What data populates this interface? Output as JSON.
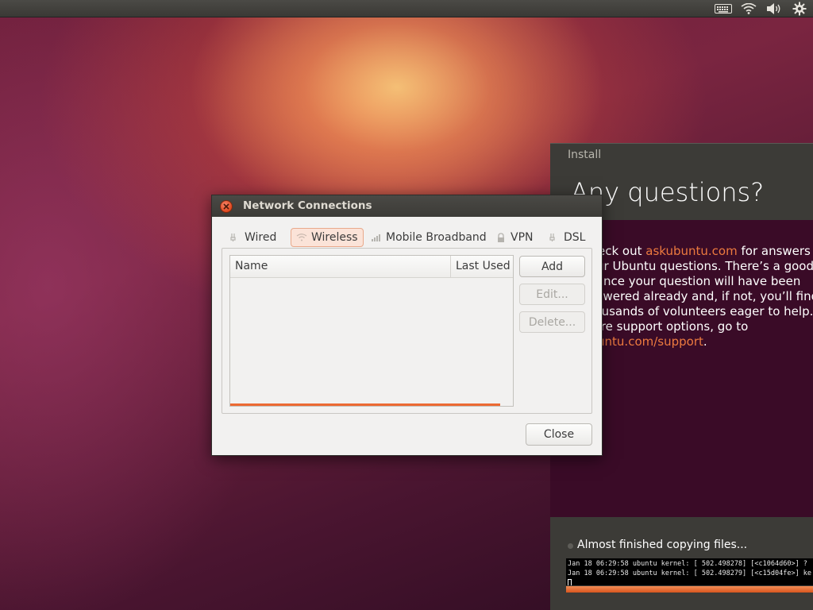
{
  "colors": {
    "accent": "#ec6a33",
    "link": "#ed7a3f",
    "panel": "#3c3b37",
    "dialog_bg": "#f2f1f0"
  },
  "top_panel": {
    "indicators": [
      "keyboard-icon",
      "wifi-icon",
      "volume-icon",
      "gear-icon"
    ]
  },
  "installer": {
    "window_title": "Install",
    "heading": "Any questions?",
    "body": {
      "line1_pre": "Check out ",
      "line1_link": "askubuntu.com",
      "line1_post": " for answers to",
      "line2": "your Ubuntu questions. There’s a good",
      "line3": "chance your question will have been",
      "line4": "answered already and, if not, you’ll find",
      "line5": "thousands of volunteers eager to help. For",
      "line6": "more support options, go to",
      "line7_link": "ubuntu.com/support",
      "line7_post": "."
    },
    "status": "Almost finished copying files...",
    "terminal_lines": [
      "Jan 18 06:29:58 ubuntu kernel: [  502.498278]  [<c1064d60>] ?",
      "Jan 18 06:29:58 ubuntu kernel: [  502.498279]  [<c15d04fe>] ke"
    ],
    "progress": 1.0
  },
  "dialog": {
    "title": "Network Connections",
    "tabs": [
      {
        "label": "Wired",
        "icon": "wired-icon"
      },
      {
        "label": "Wireless",
        "icon": "wireless-icon",
        "active": true
      },
      {
        "label": "Mobile Broadband",
        "icon": "mobile-broadband-icon"
      },
      {
        "label": "VPN",
        "icon": "vpn-lock-icon"
      },
      {
        "label": "DSL",
        "icon": "dsl-icon"
      }
    ],
    "columns": [
      "Name",
      "Last Used"
    ],
    "rows": [],
    "buttons": {
      "add": "Add",
      "edit": "Edit...",
      "delete": "Delete..."
    },
    "close_label": "Close"
  }
}
